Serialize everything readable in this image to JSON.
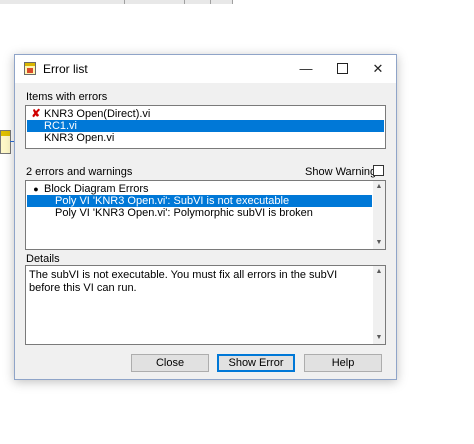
{
  "window": {
    "title": "Error list",
    "minimize_glyph": "—",
    "close_glyph": "✕"
  },
  "items_section": {
    "label": "Items with errors",
    "items": [
      {
        "icon": "red-x-icon",
        "text": "KNR3 Open(Direct).vi",
        "selected": false
      },
      {
        "icon": "",
        "text": "RC1.vi",
        "selected": true
      },
      {
        "icon": "",
        "text": "KNR3 Open.vi",
        "selected": false
      }
    ]
  },
  "errors_section": {
    "summary": "2 errors and warnings",
    "show_warnings_label": "Show Warnings",
    "show_warnings_checked": false,
    "items": [
      {
        "text": "Block Diagram Errors",
        "selected": false,
        "bullet": "●"
      },
      {
        "text": "Poly VI 'KNR3 Open.vi': SubVI is not executable",
        "selected": true
      },
      {
        "text": "Poly VI 'KNR3 Open.vi': Polymorphic subVI is broken",
        "selected": false
      }
    ]
  },
  "details": {
    "label": "Details",
    "text": "The subVI is not executable. You must fix all errors in the subVI before this VI can run."
  },
  "buttons": {
    "close": "Close",
    "show_error": "Show Error",
    "help": "Help"
  },
  "colors": {
    "selection": "#0078d7",
    "error_mark": "#d00000"
  }
}
